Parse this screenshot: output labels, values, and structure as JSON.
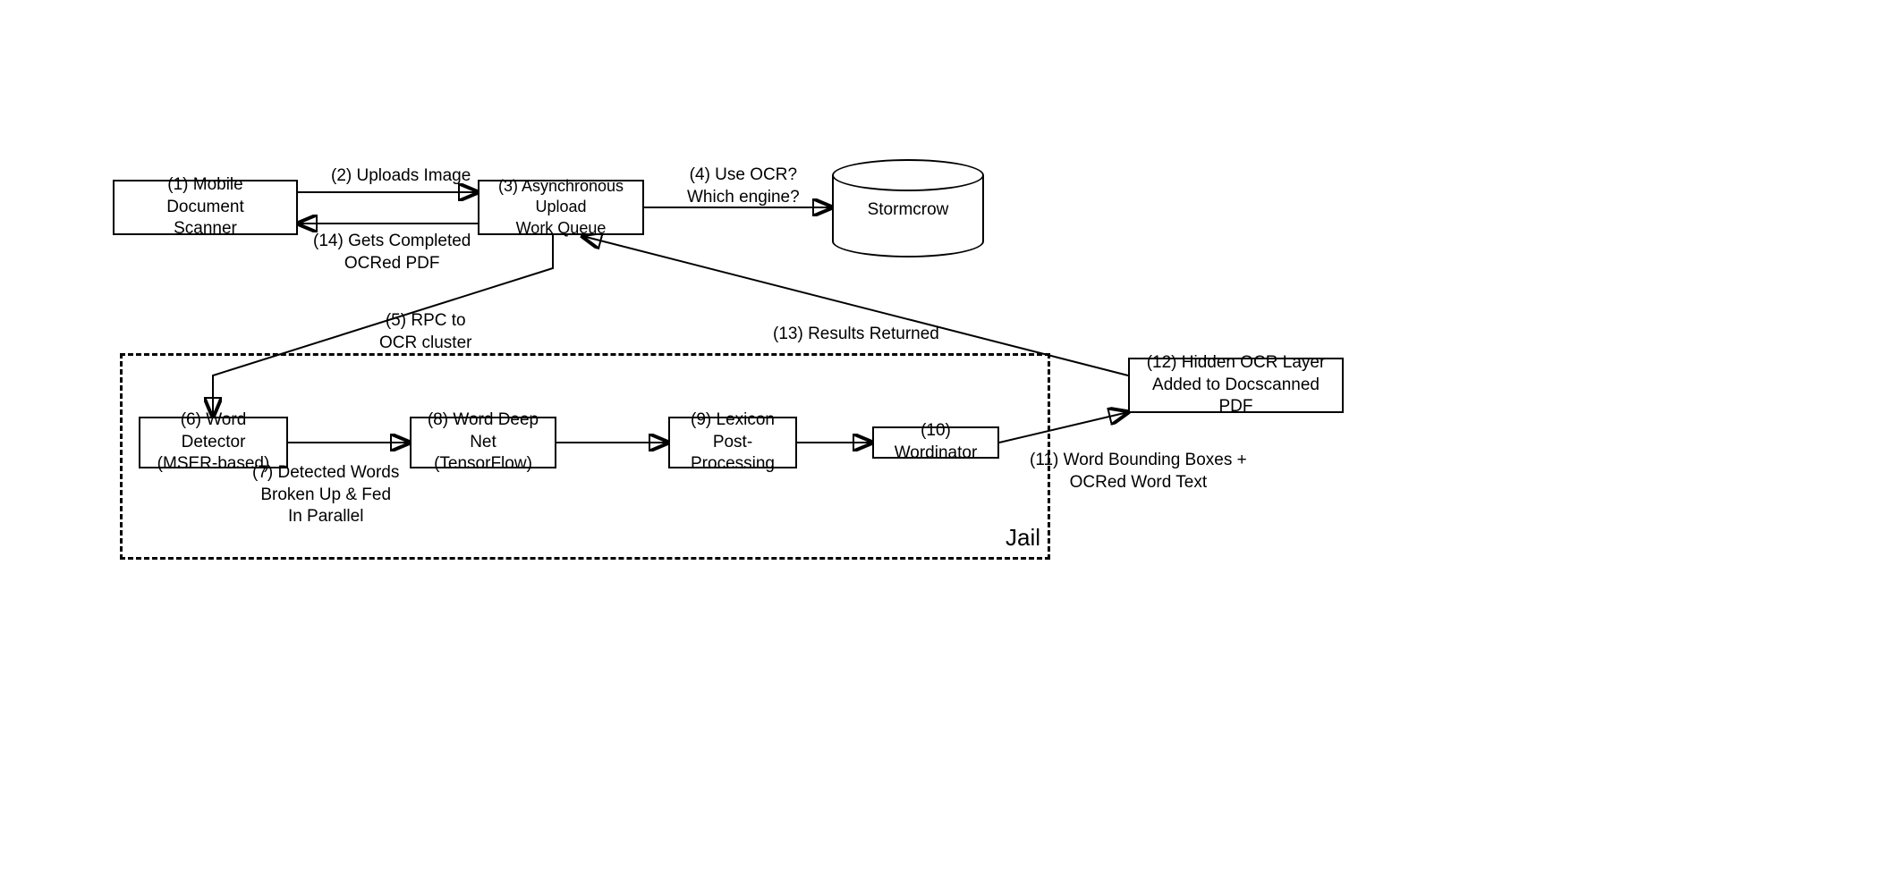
{
  "nodes": {
    "mobile": "(1) Mobile Document\nScanner",
    "queue": "(3) Asynchronous Upload\nWork Queue",
    "stormcrow": "Stormcrow",
    "word_detector": "(6) Word Detector\n(MSER-based)",
    "word_deep_net": "(8) Word Deep Net\n(TensorFlow)",
    "lexicon": "(9) Lexicon\nPost-Processing",
    "wordinator": "(10) Wordinator",
    "hidden_layer": "(12) Hidden OCR Layer\nAdded to Docscanned PDF"
  },
  "edges": {
    "uploads_image": "(2) Uploads Image",
    "gets_pdf": "(14) Gets Completed\nOCRed PDF",
    "use_ocr": "(4) Use OCR?\nWhich engine?",
    "rpc": "(5) RPC to\nOCR cluster",
    "detected_words": "(7) Detected Words\nBroken Up & Fed\nIn Parallel",
    "bounding_boxes": "(11) Word Bounding Boxes +\nOCRed Word Text",
    "results_returned": "(13) Results Returned"
  },
  "container": {
    "jail": "Jail"
  }
}
